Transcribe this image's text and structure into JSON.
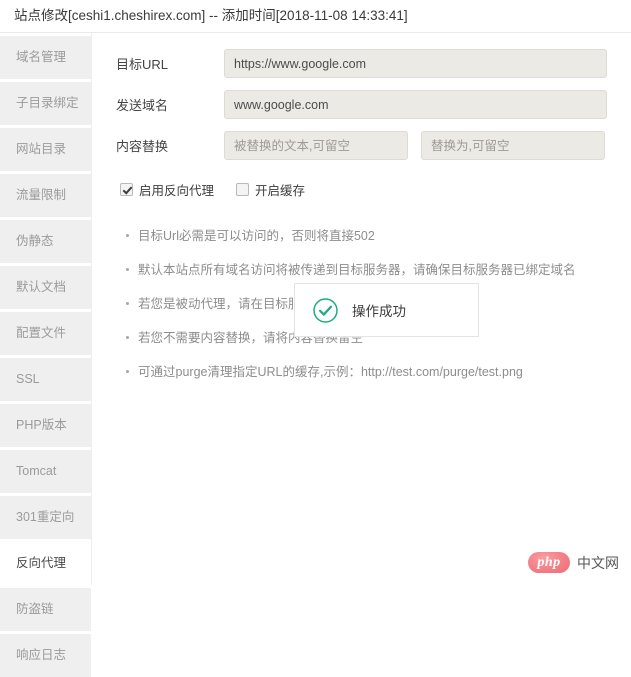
{
  "titlebar": {
    "title": "站点修改[ceshi1.cheshirex.com] -- 添加时间[2018-11-08 14:33:41]"
  },
  "sidebar": {
    "items": [
      {
        "label": "域名管理",
        "active": false
      },
      {
        "label": "子目录绑定",
        "active": false
      },
      {
        "label": "网站目录",
        "active": false
      },
      {
        "label": "流量限制",
        "active": false
      },
      {
        "label": "伪静态",
        "active": false
      },
      {
        "label": "默认文档",
        "active": false
      },
      {
        "label": "配置文件",
        "active": false
      },
      {
        "label": "SSL",
        "active": false
      },
      {
        "label": "PHP版本",
        "active": false
      },
      {
        "label": "Tomcat",
        "active": false
      },
      {
        "label": "301重定向",
        "active": false
      },
      {
        "label": "反向代理",
        "active": true
      },
      {
        "label": "防盗链",
        "active": false
      },
      {
        "label": "响应日志",
        "active": false
      }
    ]
  },
  "form": {
    "target_url": {
      "label": "目标URL",
      "value": "https://www.google.com"
    },
    "send_domain": {
      "label": "发送域名",
      "value": "www.google.com"
    },
    "content_replace": {
      "label": "内容替换",
      "from_placeholder": "被替换的文本,可留空",
      "from_value": "",
      "to_placeholder": "替换为,可留空",
      "to_value": ""
    },
    "checkboxes": [
      {
        "label": "启用反向代理",
        "checked": true
      },
      {
        "label": "开启缓存",
        "checked": false
      }
    ]
  },
  "hints": [
    "目标Url必需是可以访问的，否则将直接502",
    "默认本站点所有域名访问将被传递到目标服务器，请确保目标服务器已绑定域名",
    "若您是被动代理，请在目标服务器上绑定本站点的域名",
    "若您不需要内容替换，请将内容替换留空",
    "可通过purge清理指定URL的缓存,示例：http://test.com/purge/test.png"
  ],
  "toast": {
    "message": "操作成功",
    "icon": "success-check-icon",
    "accent_color": "#1aad80"
  },
  "watermark": {
    "badge": "php",
    "text": "中文网"
  }
}
